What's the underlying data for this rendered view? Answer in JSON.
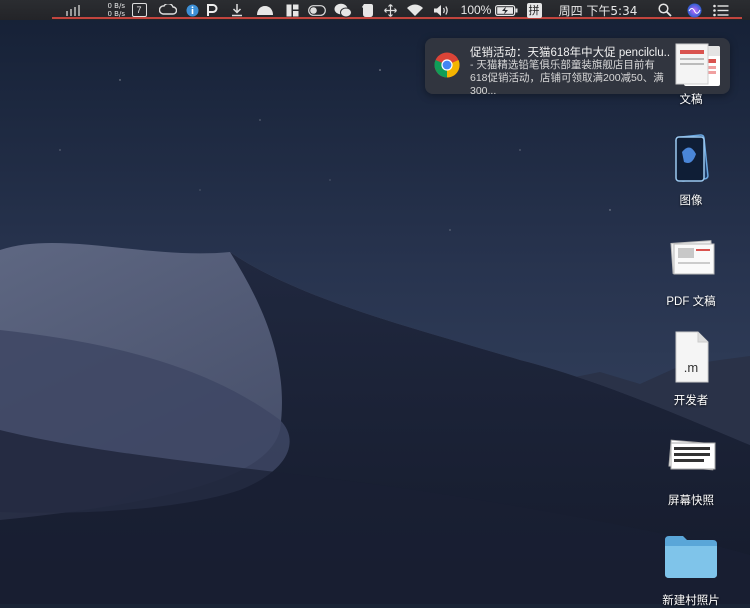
{
  "menubar": {
    "net_up": "0 B/s",
    "net_down": "0 B/s",
    "calendar_day": "7",
    "battery_percent": "100%",
    "input_method": "拼",
    "datetime": "周四 下午5:34"
  },
  "notification": {
    "title": "促销活动：天猫618年中大促 pencilclu...",
    "body": "- 天猫精选铅笔俱乐部童装旗舰店目前有618促销活动，店铺可领取满200减50、满300...",
    "app_icon": "chrome-icon"
  },
  "desktop": {
    "items": [
      {
        "label": "文稿"
      },
      {
        "label": "图像"
      },
      {
        "label": "PDF 文稿"
      },
      {
        "label": "开发者"
      },
      {
        "label": "屏幕快照"
      },
      {
        "label": "新建村照片"
      }
    ],
    "dev_file_ext": ".m"
  },
  "colors": {
    "menubar_bg": "#232428",
    "notification_bg": "#343840",
    "accent_red": "#c2453e",
    "folder_blue": "#7fc4ea"
  }
}
